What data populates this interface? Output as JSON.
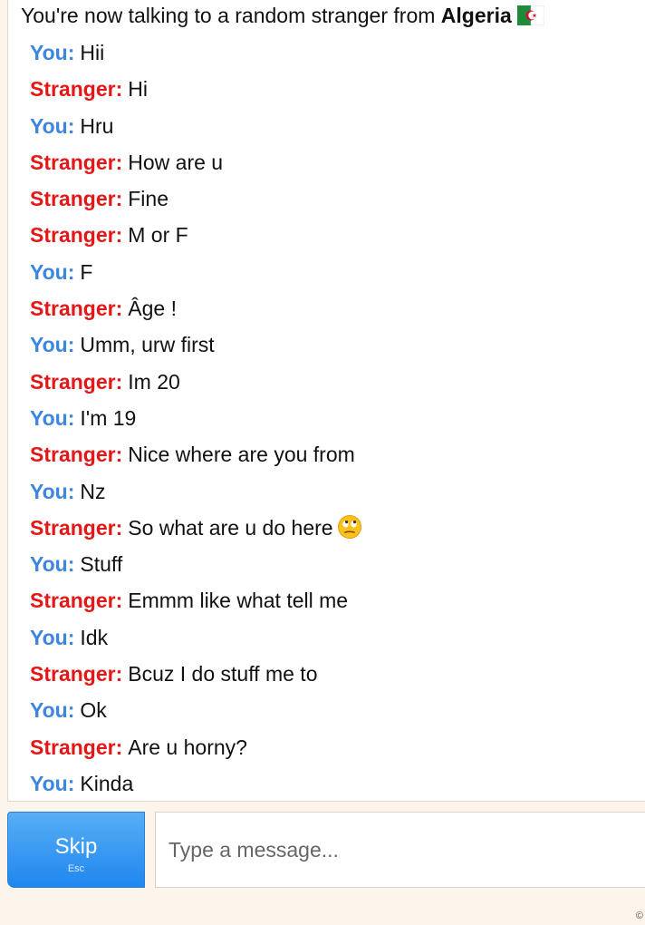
{
  "header": {
    "prefix": "You're now talking to a random stranger from ",
    "country": "Algeria"
  },
  "colors": {
    "you": "#3c86e0",
    "stranger": "#e41616",
    "skip_button": "#2b8ff0",
    "background": "#fdf4ec"
  },
  "messages": [
    {
      "speaker": "You:",
      "text": "Hii"
    },
    {
      "speaker": "Stranger:",
      "text": "Hi"
    },
    {
      "speaker": "You:",
      "text": "Hru"
    },
    {
      "speaker": "Stranger:",
      "text": "How are u"
    },
    {
      "speaker": "Stranger:",
      "text": "Fine"
    },
    {
      "speaker": "Stranger:",
      "text": "M or F"
    },
    {
      "speaker": "You:",
      "text": "F"
    },
    {
      "speaker": "Stranger:",
      "text": "Âge !"
    },
    {
      "speaker": "You:",
      "text": "Umm, urw first"
    },
    {
      "speaker": "Stranger:",
      "text": "Im 20"
    },
    {
      "speaker": "You:",
      "text": "I'm 19"
    },
    {
      "speaker": "Stranger:",
      "text": "Nice where are you from"
    },
    {
      "speaker": "You:",
      "text": "Nz"
    },
    {
      "speaker": "Stranger:",
      "text": "So what are u do here",
      "emoji": "face-with-rolling-eyes-icon"
    },
    {
      "speaker": "You:",
      "text": "Stuff"
    },
    {
      "speaker": "Stranger:",
      "text": "Emmm like what tell me"
    },
    {
      "speaker": "You:",
      "text": "Idk"
    },
    {
      "speaker": "Stranger:",
      "text": "Bcuz I do stuff me to"
    },
    {
      "speaker": "You:",
      "text": "Ok"
    },
    {
      "speaker": "Stranger:",
      "text": "Are u horny?"
    },
    {
      "speaker": "You:",
      "text": "Kinda"
    }
  ],
  "controls": {
    "skip_label": "Skip",
    "skip_key": "Esc",
    "input_placeholder": "Type a message..."
  },
  "footer": {
    "copyright": "©"
  }
}
